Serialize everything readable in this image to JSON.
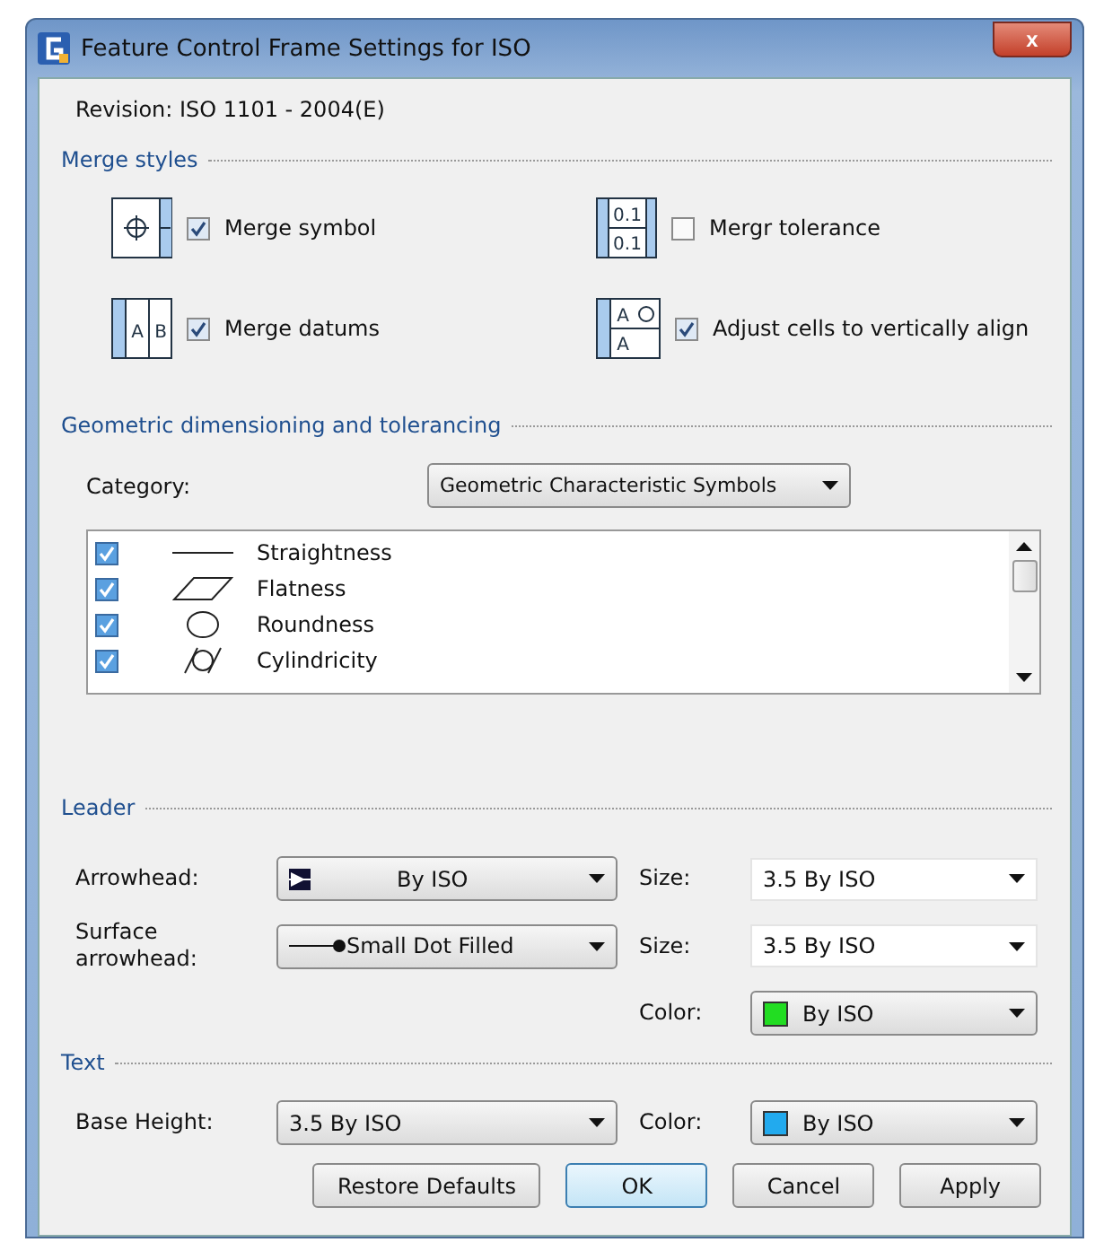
{
  "window": {
    "title": "Feature Control Frame Settings for ISO",
    "close": "x"
  },
  "revision": "Revision: ISO 1101 - 2004(E)",
  "merge_styles": {
    "heading": "Merge styles",
    "options": [
      {
        "kind": "symbol",
        "label": "Merge symbol",
        "checked": true
      },
      {
        "kind": "tolerance",
        "cells": [
          "0.1",
          "0.1"
        ],
        "label": "Mergr tolerance",
        "checked": false
      },
      {
        "kind": "datums",
        "cells": [
          "A",
          "B"
        ],
        "label": "Merge datums",
        "checked": true
      },
      {
        "kind": "align",
        "cells": [
          "A",
          "A"
        ],
        "label": "Adjust cells to vertically align",
        "checked": true
      }
    ]
  },
  "gdt": {
    "heading": "Geometric dimensioning and tolerancing",
    "category_label": "Category:",
    "category": "Geometric Characteristic Symbols",
    "items": [
      {
        "kind": "straightness",
        "label": "Straightness",
        "checked": true
      },
      {
        "kind": "flatness",
        "label": "Flatness",
        "checked": true
      },
      {
        "kind": "roundness",
        "label": "Roundness",
        "checked": true
      },
      {
        "kind": "cylindricity",
        "label": "Cylindricity",
        "checked": true
      }
    ]
  },
  "leader": {
    "heading": "Leader",
    "rows": [
      {
        "label": "Arrowhead:",
        "value": {
          "kind": "arrow",
          "text": "By ISO"
        },
        "side_label": "Size:",
        "side": {
          "kind": "editable",
          "text": "3.5 By ISO"
        }
      },
      {
        "label": "Surface arrowhead:",
        "value": {
          "kind": "dot",
          "text": "Small Dot Filled"
        },
        "side_label": "Size:",
        "side": {
          "kind": "editable",
          "text": "3.5 By ISO"
        }
      },
      {
        "side_label": "Color:",
        "side": {
          "kind": "color",
          "text": "By ISO",
          "color": "#22dd22"
        }
      }
    ]
  },
  "text": {
    "heading": "Text",
    "rows": [
      {
        "label": "Base Height:",
        "value": {
          "text": "3.5 By ISO"
        },
        "side_label": "Color:",
        "side": {
          "kind": "color",
          "text": "By ISO",
          "color": "#22aaee"
        }
      }
    ]
  },
  "buttons": [
    {
      "label": "Restore Defaults",
      "default": false
    },
    {
      "label": "OK",
      "default": true
    },
    {
      "label": "Cancel",
      "default": false
    },
    {
      "label": "Apply",
      "default": false
    }
  ]
}
